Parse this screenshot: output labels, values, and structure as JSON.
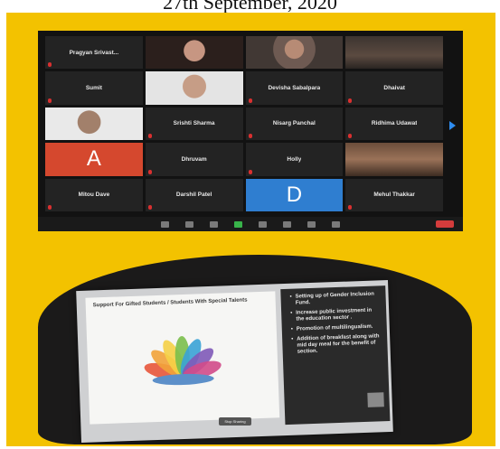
{
  "date_title": "27th September, 2020",
  "zoom": {
    "participants": [
      {
        "name": "Pragyan Srivast...",
        "type": "name"
      },
      {
        "name": "",
        "type": "video",
        "variant": "v2"
      },
      {
        "name": "",
        "type": "video",
        "variant": "v3"
      },
      {
        "name": "",
        "type": "video",
        "variant": "v1"
      },
      {
        "name": "Sumit",
        "type": "name"
      },
      {
        "name": "",
        "type": "video",
        "variant": "v4"
      },
      {
        "name": "Devisha Sabalpara",
        "type": "name"
      },
      {
        "name": "Dhaivat",
        "type": "name"
      },
      {
        "name": "",
        "type": "video",
        "variant": "v5"
      },
      {
        "name": "Srishti Sharma",
        "type": "name"
      },
      {
        "name": "Nisarg Panchal",
        "type": "name"
      },
      {
        "name": "Ridhima Udawat",
        "type": "name"
      },
      {
        "name": "",
        "type": "avatar",
        "letter": "A",
        "color": "#d5482e"
      },
      {
        "name": "Dhruvam",
        "type": "name"
      },
      {
        "name": "Holly",
        "type": "name"
      },
      {
        "name": "",
        "type": "video",
        "variant": "v6"
      },
      {
        "name": "Mitou Dave",
        "type": "name"
      },
      {
        "name": "Darshil Patel",
        "type": "name"
      },
      {
        "name": "",
        "type": "avatar",
        "letter": "D",
        "color": "#2f7ed0"
      },
      {
        "name": "Mehul Thakkar",
        "type": "name"
      }
    ]
  },
  "slide": {
    "title": "Support For Gifted Students / Students With Special Talents",
    "bullets": [
      "Setting up of Gender Inclusion Fund.",
      "Increase public investment in the education sector .",
      "Promotion of multilingualism.",
      "Addition of breakfast along with mid day meal for the benefit of section."
    ],
    "stop_share_label": "Stop Sharing",
    "lotus_colors": [
      "#e8573b",
      "#f2a33a",
      "#f5d046",
      "#7bbf4b",
      "#3aa3d6",
      "#7f5ab8",
      "#d24b8a"
    ]
  },
  "colors": {
    "frame": "#f3c200",
    "zoom_bg": "#121212",
    "tile_bg": "#232323"
  }
}
